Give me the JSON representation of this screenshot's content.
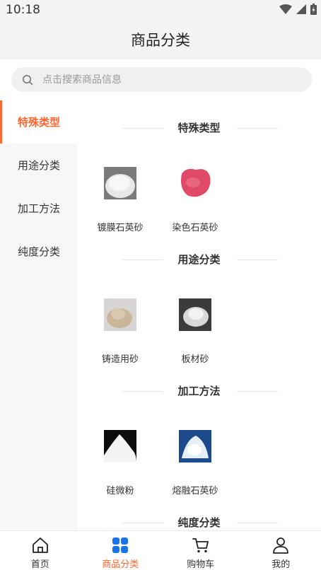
{
  "status": {
    "time": "10:18"
  },
  "header": {
    "title": "商品分类"
  },
  "search": {
    "placeholder": "点击搜索商品信息"
  },
  "sidebar": {
    "items": [
      {
        "label": "特殊类型",
        "active": true
      },
      {
        "label": "用途分类",
        "active": false
      },
      {
        "label": "加工方法",
        "active": false
      },
      {
        "label": "纯度分类",
        "active": false
      }
    ]
  },
  "sections": [
    {
      "title": "特殊类型",
      "products": [
        {
          "name": "镀膜石英砂"
        },
        {
          "name": "染色石英砂"
        }
      ]
    },
    {
      "title": "用途分类",
      "products": [
        {
          "name": "铸造用砂"
        },
        {
          "name": "板材砂"
        }
      ]
    },
    {
      "title": "加工方法",
      "products": [
        {
          "name": "硅微粉"
        },
        {
          "name": "熔融石英砂"
        }
      ]
    },
    {
      "title": "纯度分类",
      "products": []
    }
  ],
  "tabbar": {
    "items": [
      {
        "label": "首页",
        "icon": "home-icon"
      },
      {
        "label": "商品分类",
        "icon": "category-icon",
        "active": true
      },
      {
        "label": "购物车",
        "icon": "cart-icon"
      },
      {
        "label": "我的",
        "icon": "user-icon"
      }
    ]
  },
  "colors": {
    "accent": "#ff6633",
    "text": "#333333"
  }
}
